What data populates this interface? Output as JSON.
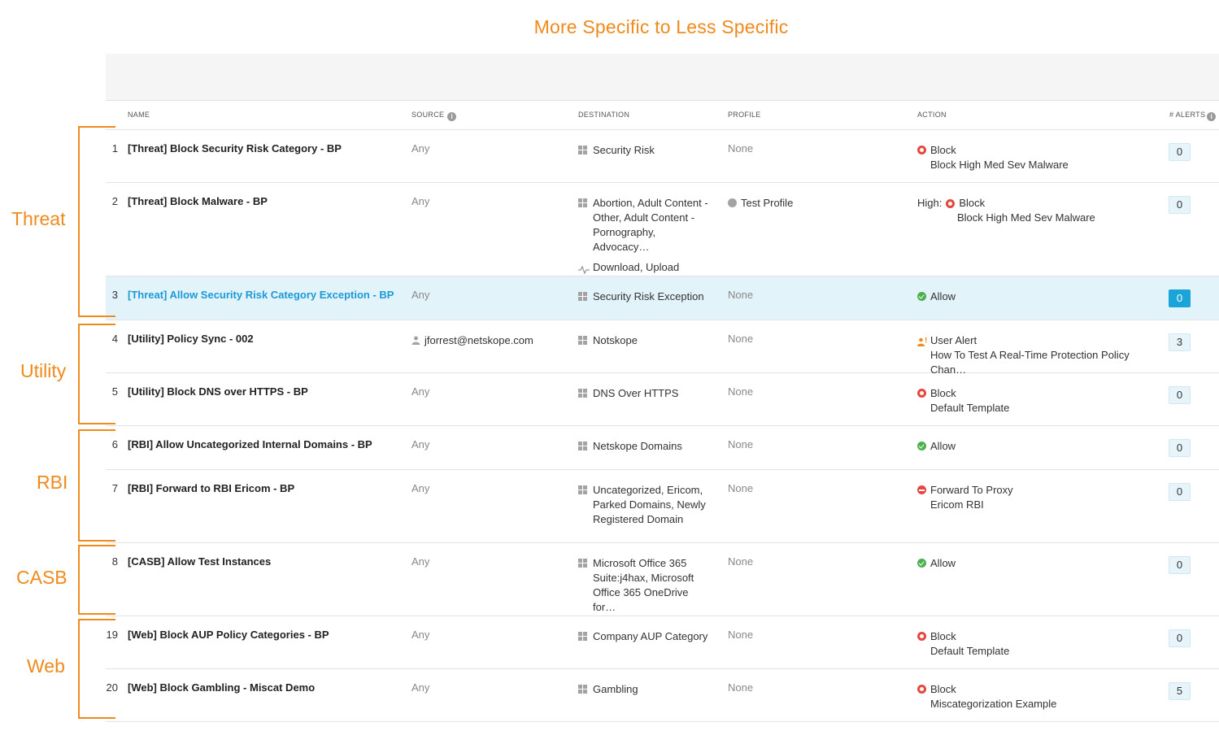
{
  "title": "More Specific to Less Specific",
  "headers": {
    "name": "NAME",
    "source": "SOURCE",
    "destination": "DESTINATION",
    "profile": "PROFILE",
    "action": "ACTION",
    "alerts": "# ALERTS"
  },
  "groups": {
    "threat": "Threat",
    "utility": "Utility",
    "rbi": "RBI",
    "casb": "CASB",
    "web": "Web"
  },
  "colors": {
    "accent": "#f08a1c",
    "selected": "#e3f3fa",
    "link": "#1a9ad6",
    "block": "#e5473f",
    "allow": "#4cb050"
  },
  "rows": [
    {
      "num": "1",
      "name": "[Threat] Block Security Risk Category - BP",
      "source": "Any",
      "destination": [
        "Security Risk"
      ],
      "profile": "None",
      "action_prefix": "",
      "action": "Block",
      "action_sub": "Block High Med Sev Malware",
      "alerts": "0"
    },
    {
      "num": "2",
      "name": "[Threat] Block Malware - BP",
      "source": "Any",
      "destination": [
        "Abortion, Adult Content - Other, Adult Content - Pornography, Advocacy…"
      ],
      "destination_activity": "Download, Upload",
      "profile": "Test Profile",
      "action_prefix": "High:",
      "action": "Block",
      "action_sub": "Block High Med Sev Malware",
      "alerts": "0"
    },
    {
      "num": "3",
      "name": "[Threat] Allow Security Risk Category Exception - BP",
      "source": "Any",
      "destination": [
        "Security Risk Exception"
      ],
      "profile": "None",
      "action": "Allow",
      "alerts": "0"
    },
    {
      "num": "4",
      "name": "[Utility] Policy Sync - 002",
      "source": "jforrest@netskope.com",
      "destination": [
        "Notskope"
      ],
      "profile": "None",
      "action": "User Alert",
      "action_sub": "How To Test A Real-Time Protection Policy Chan…",
      "alerts": "3"
    },
    {
      "num": "5",
      "name": "[Utility] Block DNS over HTTPS - BP",
      "source": "Any",
      "destination": [
        "DNS Over HTTPS"
      ],
      "profile": "None",
      "action": "Block",
      "action_sub": "Default Template",
      "alerts": "0"
    },
    {
      "num": "6",
      "name": "[RBI] Allow Uncategorized Internal Domains - BP",
      "source": "Any",
      "destination": [
        "Netskope Domains"
      ],
      "profile": "None",
      "action": "Allow",
      "alerts": "0"
    },
    {
      "num": "7",
      "name": "[RBI] Forward to RBI Ericom - BP",
      "source": "Any",
      "destination": [
        "Uncategorized, Ericom, Parked Domains, Newly Registered Domain"
      ],
      "profile": "None",
      "action": "Forward To Proxy",
      "action_sub": "Ericom RBI",
      "alerts": "0"
    },
    {
      "num": "8",
      "name": "[CASB] Allow Test Instances",
      "source": "Any",
      "destination": [
        "Microsoft Office 365 Suite:j4hax, Microsoft Office 365 OneDrive for…"
      ],
      "profile": "None",
      "action": "Allow",
      "alerts": "0"
    },
    {
      "num": "19",
      "name": "[Web] Block AUP Policy Categories - BP",
      "source": "Any",
      "destination": [
        "Company AUP Category"
      ],
      "profile": "None",
      "action": "Block",
      "action_sub": "Default Template",
      "alerts": "0"
    },
    {
      "num": "20",
      "name": "[Web] Block Gambling - Miscat Demo",
      "source": "Any",
      "destination": [
        "Gambling"
      ],
      "profile": "None",
      "action": "Block",
      "action_sub": "Miscategorization Example",
      "alerts": "5"
    }
  ]
}
